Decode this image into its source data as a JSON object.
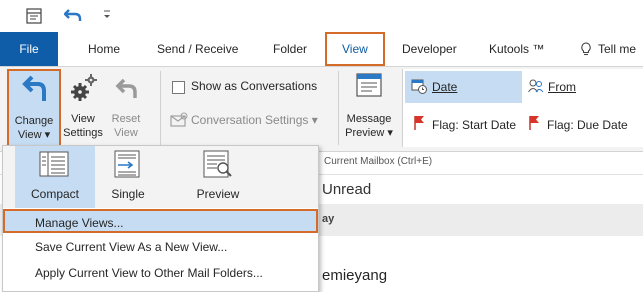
{
  "tabs": {
    "file": "File",
    "home": "Home",
    "send_receive": "Send / Receive",
    "folder": "Folder",
    "view": "View",
    "developer": "Developer",
    "kutools": "Kutools ™",
    "tell_me": "Tell me"
  },
  "ribbon": {
    "change_view": {
      "line1": "Change",
      "line2": "View ▾"
    },
    "view_settings": {
      "line1": "View",
      "line2": "Settings"
    },
    "reset_view": {
      "line1": "Reset",
      "line2": "View"
    },
    "show_as_conversations": "Show as Conversations",
    "conversation_settings": "Conversation Settings ▾",
    "message_preview": {
      "line1": "Message",
      "line2": "Preview ▾"
    },
    "arrangement": {
      "date": "Date",
      "from": "From",
      "flag_start_date": "Flag: Start Date",
      "flag_due_date": "Flag: Due Date"
    }
  },
  "content": {
    "search_placeholder": "Current Mailbox (Ctrl+E)",
    "unread": "Unread",
    "group_header": "ay",
    "sender": "emieyang"
  },
  "dropdown": {
    "views": [
      {
        "label": "Compact",
        "selected": true
      },
      {
        "label": "Single",
        "selected": false
      },
      {
        "label": "Preview",
        "selected": false
      }
    ],
    "manage_views": "Manage Views...",
    "save_view": "Save Current View As a New View...",
    "apply_view": "Apply Current View to Other Mail Folders..."
  },
  "colors": {
    "file_tab": "#0f5ca8",
    "highlight_box": "#d46b28",
    "selection": "#c5dcf2",
    "accent_blue": "#2b78c5"
  }
}
